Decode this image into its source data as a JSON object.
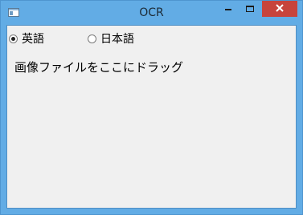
{
  "window": {
    "title": "OCR",
    "colors": {
      "titlebar": "#62ace5",
      "close_button": "#c7443c",
      "client_background": "#f0f0f0"
    }
  },
  "title_buttons": {
    "minimize_icon": "minimize-icon",
    "maximize_icon": "maximize-icon",
    "close_icon": "close-icon"
  },
  "language_options": {
    "english_label": "英語",
    "japanese_label": "日本語",
    "selected": "英語"
  },
  "drop_area": {
    "label": "画像ファイルをここにドラッグ"
  }
}
